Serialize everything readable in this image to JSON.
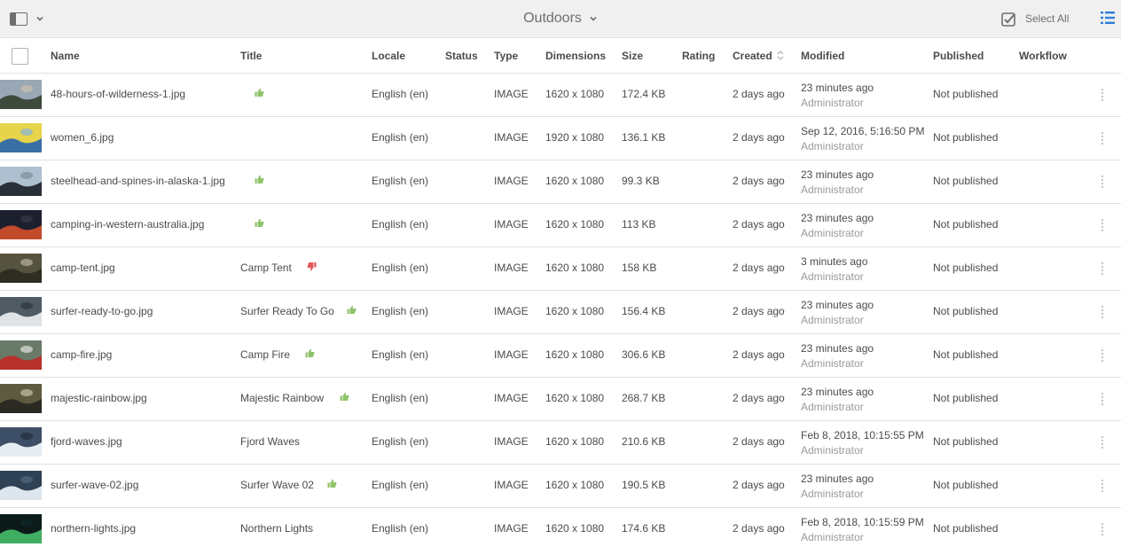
{
  "header": {
    "title": "Outdoors",
    "select_all": "Select All",
    "icons": [
      "rail-toggle-icon",
      "chevron-down-icon",
      "checkbox-checked-icon",
      "list-view-icon"
    ]
  },
  "columns": {
    "name": "Name",
    "title": "Title",
    "locale": "Locale",
    "status": "Status",
    "type": "Type",
    "dimensions": "Dimensions",
    "size": "Size",
    "rating": "Rating",
    "created": "Created",
    "modified": "Modified",
    "published": "Published",
    "workflow": "Workflow"
  },
  "colors": {
    "approved": "#8fc36a",
    "rejected": "#e55a5a",
    "accent_list_icon": "#2d7fd8"
  },
  "rows": [
    {
      "name": "48-hours-of-wilderness-1.jpg",
      "title": "",
      "review": "approved",
      "locale": "English (en)",
      "type": "IMAGE",
      "dimensions": "1620 x 1080",
      "size": "172.4 KB",
      "created": "2 days ago",
      "modified": "23 minutes ago",
      "modified_by": "Administrator",
      "published": "Not published"
    },
    {
      "name": "women_6.jpg",
      "title": "",
      "review": "",
      "locale": "English (en)",
      "type": "IMAGE",
      "dimensions": "1920 x 1080",
      "size": "136.1 KB",
      "created": "2 days ago",
      "modified": "Sep 12, 2016, 5:16:50 PM",
      "modified_by": "Administrator",
      "published": "Not published"
    },
    {
      "name": "steelhead-and-spines-in-alaska-1.jpg",
      "title": "",
      "review": "approved",
      "locale": "English (en)",
      "type": "IMAGE",
      "dimensions": "1620 x 1080",
      "size": "99.3 KB",
      "created": "2 days ago",
      "modified": "23 minutes ago",
      "modified_by": "Administrator",
      "published": "Not published"
    },
    {
      "name": "camping-in-western-australia.jpg",
      "title": "",
      "review": "approved",
      "locale": "English (en)",
      "type": "IMAGE",
      "dimensions": "1620 x 1080",
      "size": "113 KB",
      "created": "2 days ago",
      "modified": "23 minutes ago",
      "modified_by": "Administrator",
      "published": "Not published"
    },
    {
      "name": "camp-tent.jpg",
      "title": "Camp Tent",
      "review": "rejected",
      "locale": "English (en)",
      "type": "IMAGE",
      "dimensions": "1620 x 1080",
      "size": "158 KB",
      "created": "2 days ago",
      "modified": "3 minutes ago",
      "modified_by": "Administrator",
      "published": "Not published"
    },
    {
      "name": "surfer-ready-to-go.jpg",
      "title": "Surfer Ready To Go",
      "review": "approved",
      "locale": "English (en)",
      "type": "IMAGE",
      "dimensions": "1620 x 1080",
      "size": "156.4 KB",
      "created": "2 days ago",
      "modified": "23 minutes ago",
      "modified_by": "Administrator",
      "published": "Not published"
    },
    {
      "name": "camp-fire.jpg",
      "title": "Camp Fire",
      "review": "approved",
      "locale": "English (en)",
      "type": "IMAGE",
      "dimensions": "1620 x 1080",
      "size": "306.6 KB",
      "created": "2 days ago",
      "modified": "23 minutes ago",
      "modified_by": "Administrator",
      "published": "Not published"
    },
    {
      "name": "majestic-rainbow.jpg",
      "title": "Majestic Rainbow",
      "review": "approved",
      "locale": "English (en)",
      "type": "IMAGE",
      "dimensions": "1620 x 1080",
      "size": "268.7 KB",
      "created": "2 days ago",
      "modified": "23 minutes ago",
      "modified_by": "Administrator",
      "published": "Not published"
    },
    {
      "name": "fjord-waves.jpg",
      "title": "Fjord Waves",
      "review": "",
      "locale": "English (en)",
      "type": "IMAGE",
      "dimensions": "1620 x 1080",
      "size": "210.6 KB",
      "created": "2 days ago",
      "modified": "Feb 8, 2018, 10:15:55 PM",
      "modified_by": "Administrator",
      "published": "Not published"
    },
    {
      "name": "surfer-wave-02.jpg",
      "title": "Surfer Wave 02",
      "review": "approved",
      "locale": "English (en)",
      "type": "IMAGE",
      "dimensions": "1620 x 1080",
      "size": "190.5 KB",
      "created": "2 days ago",
      "modified": "23 minutes ago",
      "modified_by": "Administrator",
      "published": "Not published"
    },
    {
      "name": "northern-lights.jpg",
      "title": "Northern Lights",
      "review": "",
      "locale": "English (en)",
      "type": "IMAGE",
      "dimensions": "1620 x 1080",
      "size": "174.6 KB",
      "created": "2 days ago",
      "modified": "Feb 8, 2018, 10:15:59 PM",
      "modified_by": "Administrator",
      "published": "Not published"
    }
  ]
}
